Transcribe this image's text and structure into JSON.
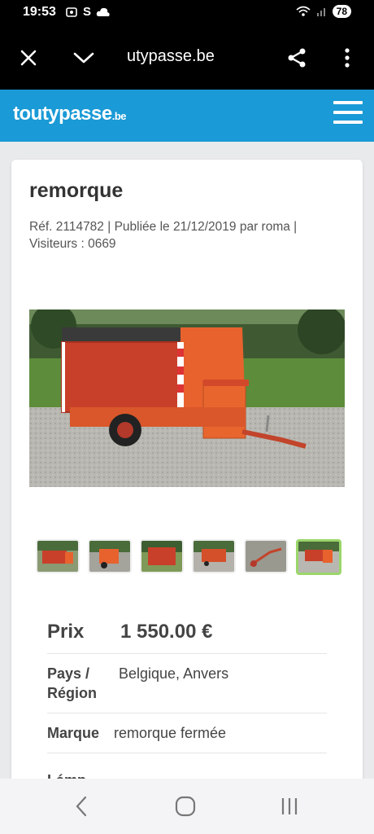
{
  "status_bar": {
    "time": "19:53",
    "battery": "78"
  },
  "browser": {
    "url": "utypasse.be"
  },
  "site": {
    "logo_main": "toutypasse",
    "logo_tld": ".be"
  },
  "listing": {
    "title": "remorque",
    "meta_line1": "Réf. 2114782 | Publiée le 21/12/2019 par roma |",
    "meta_line2": "Visiteurs : 0669",
    "thumbnail_count": 6,
    "selected_thumbnail": 6,
    "price_label": "Prix",
    "price_value": "1 550.00 €",
    "country_label_1": "Pays /",
    "country_label_2": "Région",
    "country_value": "Belgique, Anvers",
    "brand_label": "Marque",
    "brand_value": "remorque fermée",
    "next_label_partial": "Lámp"
  },
  "colors": {
    "header": "#1a9ad6",
    "selected_thumb": "#9ad66a",
    "trailer": "#e8622e"
  },
  "icons": [
    "close-icon",
    "chevron-down-icon",
    "share-icon",
    "more-vert-icon",
    "hamburger-icon",
    "back-icon",
    "home-icon",
    "recents-icon"
  ]
}
